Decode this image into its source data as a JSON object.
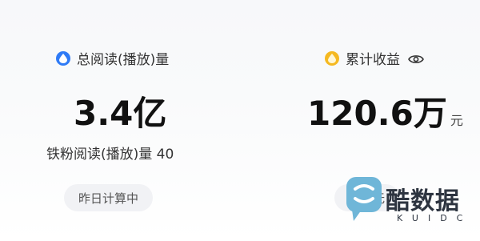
{
  "metrics": {
    "reads": {
      "icon": "water-drop-icon",
      "icon_color": "#2f7bf6",
      "label": "总阅读(播放)量",
      "value": "3.4亿",
      "sub_label": "铁粉阅读(播放)量 40",
      "status": "昨日计算中"
    },
    "earnings": {
      "icon": "coin-icon",
      "icon_color": "#f5b921",
      "label": "累计收益",
      "visibility_icon": "eye-icon",
      "value": "120.6万",
      "unit": "元",
      "status": "昨日无"
    }
  },
  "watermark": {
    "text": "酷数据",
    "subtext": "KUIDC"
  }
}
